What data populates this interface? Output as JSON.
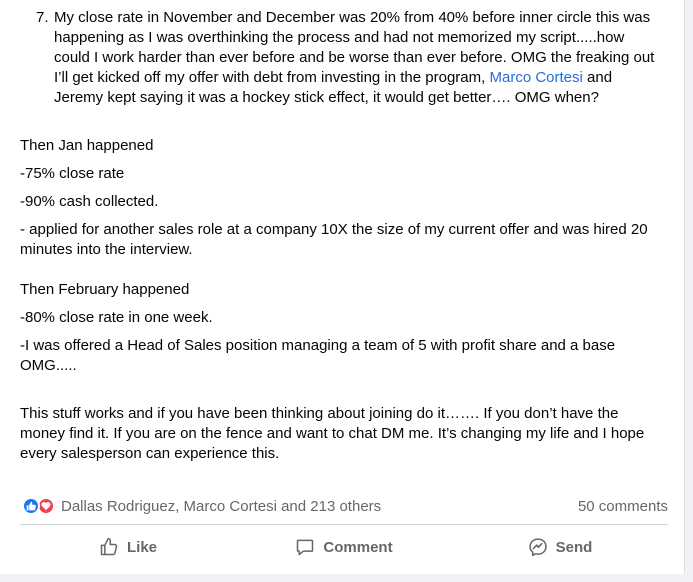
{
  "post": {
    "item7": {
      "number": "7.",
      "text_before": "My close rate in November and December was 20% from 40% before inner circle this was happening as I was overthinking the process and had not memorized my script.....how could I work harder than ever before and be worse than ever before. OMG the freaking out I’ll get kicked off my offer with debt from investing in the program, ",
      "mention": "Marco Cortesi",
      "text_after": " and Jeremy kept saying it was a hockey stick effect, it would get better…. OMG when?"
    },
    "jan_heading": "Then Jan happened",
    "jan_close_rate": "-75% close rate",
    "jan_cash": "-90% cash collected.",
    "jan_applied": "- applied for another sales role at a company 10X the size of my current offer and was hired 20 minutes into the interview.",
    "feb_heading": "Then February happened",
    "feb_close_rate": "-80% close rate in one week.",
    "feb_offer": "-I was offered a Head of Sales position managing a team of 5 with profit share and a base OMG.....",
    "closing": "This stuff works and if you have been thinking about joining do it……. If you don’t have the money find it. If you are on the fence and want to chat DM me. It’s changing my life and I hope every salesperson can experience this."
  },
  "reactions": {
    "icons": [
      "like-icon",
      "love-icon"
    ],
    "names": "Dallas Rodriguez, Marco Cortesi and 213 others",
    "comments": "50 comments"
  },
  "actions": {
    "like": "Like",
    "comment": "Comment",
    "send": "Send"
  },
  "colors": {
    "link": "#216fdb",
    "like_blue": "#1877f2",
    "love_red": "#f33e58",
    "muted": "#65676b"
  }
}
